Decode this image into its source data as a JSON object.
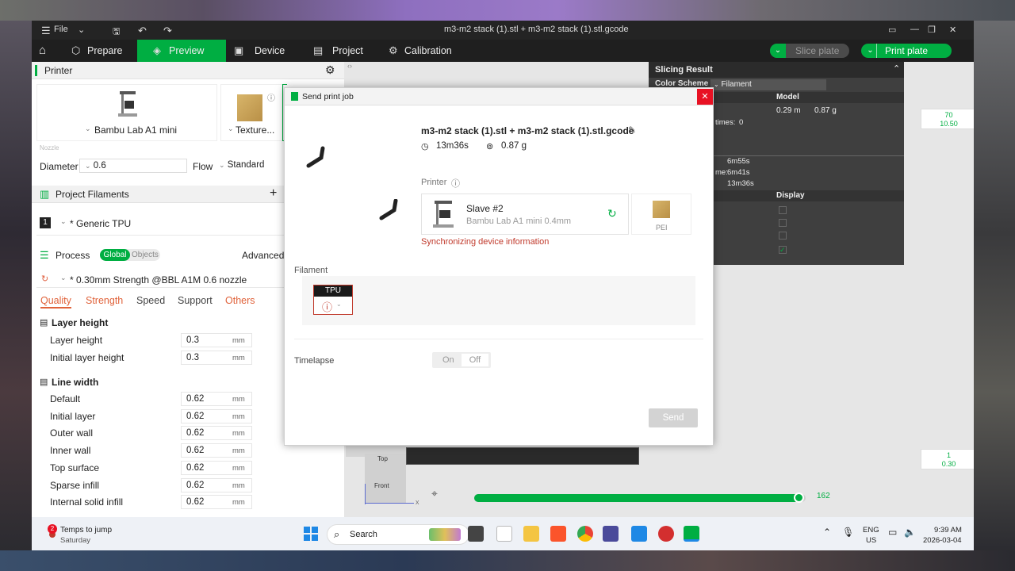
{
  "window": {
    "file_label": "File",
    "title": "m3-m2 stack (1).stl + m3-m2 stack (1).stl.gcode"
  },
  "nav": {
    "prepare": "Prepare",
    "preview": "Preview",
    "device": "Device",
    "project": "Project",
    "calibration": "Calibration",
    "slice_plate": "Slice plate",
    "print_plate": "Print plate"
  },
  "sidebar": {
    "printer_header": "Printer",
    "printer_name": "Bambu Lab A1 mini",
    "plate_name": "Texture...",
    "nozzle_label": "Nozzle",
    "diameter_label": "Diameter",
    "diameter_value": "0.6",
    "flow_label": "Flow",
    "flow_value": "Standard",
    "filaments_header": "Project Filaments",
    "filament_index": "1",
    "filament_name": "* Generic TPU",
    "process_header": "Process",
    "global_toggle": "Global",
    "objects_toggle": "Objects",
    "advanced_label": "Advanced",
    "process_profile": "* 0.30mm Strength @BBL A1M 0.6 nozzle",
    "tabs": [
      "Quality",
      "Strength",
      "Speed",
      "Support",
      "Others"
    ],
    "layer_height_group": "Layer height",
    "line_width_group": "Line width",
    "layer_rows": [
      {
        "label": "Layer height",
        "value": "0.3",
        "unit": "mm"
      },
      {
        "label": "Initial layer height",
        "value": "0.3",
        "unit": "mm"
      }
    ],
    "line_rows": [
      {
        "label": "Default",
        "value": "0.62",
        "unit": "mm"
      },
      {
        "label": "Initial layer",
        "value": "0.62",
        "unit": "mm"
      },
      {
        "label": "Outer wall",
        "value": "0.62",
        "unit": "mm"
      },
      {
        "label": "Inner wall",
        "value": "0.62",
        "unit": "mm"
      },
      {
        "label": "Top surface",
        "value": "0.62",
        "unit": "mm"
      },
      {
        "label": "Sparse infill",
        "value": "0.62",
        "unit": "mm"
      },
      {
        "label": "Internal solid infill",
        "value": "0.62",
        "unit": "mm"
      }
    ]
  },
  "slicing": {
    "title": "Slicing Result",
    "color_scheme_label": "Color Scheme",
    "color_scheme_value": "Filament",
    "model_col": "Model",
    "model_length": "0.29 m",
    "model_weight": "0.87 g",
    "times_label": "times:",
    "times_value": "0",
    "time1": "6m55s",
    "time2_label": "me:",
    "time2": "6m41s",
    "time3": "13m36s",
    "display_col": "Display"
  },
  "viewport": {
    "layer_top_value": "70",
    "layer_top_height": "10.50",
    "layer_bottom_value": "1",
    "layer_bottom_height": "0.30",
    "progress_value": "162",
    "progress_fraction": 0.98,
    "cube_top": "Top",
    "cube_front": "Front",
    "axis_x": "x"
  },
  "dialog": {
    "title": "Send print job",
    "file_name": "m3-m2 stack (1).stl + m3-m2 stack (1).stl.gcode",
    "print_time": "13m36s",
    "weight": "0.87 g",
    "printer_label": "Printer",
    "printer_name": "Slave #2",
    "printer_model": "Bambu Lab A1 mini  0.4mm",
    "plate_label": "PEI",
    "sync_message": "Synchronizing device information",
    "filament_label": "Filament",
    "filament_type": "TPU",
    "timelapse_label": "Timelapse",
    "on_label": "On",
    "off_label": "Off",
    "send_button": "Send"
  },
  "taskbar": {
    "weather_title": "Temps to jump",
    "weather_sub": "Saturday",
    "notif_count": "2",
    "search_label": "Search",
    "lang1": "ENG",
    "lang2": "US",
    "time": "9:39 AM",
    "date": "2026-03-04"
  },
  "colors": {
    "accent": "#00ae42",
    "warning_text": "#c0392b",
    "close_red": "#e81123"
  }
}
